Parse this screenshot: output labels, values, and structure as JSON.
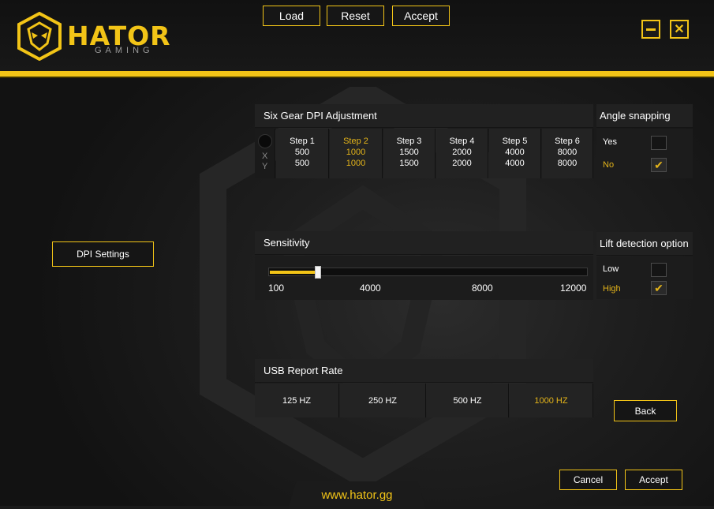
{
  "brand": {
    "name": "HATOR",
    "sub": "GAMING",
    "url": "www.hator.gg",
    "accent": "#f2c417"
  },
  "toolbar": {
    "load": "Load",
    "reset": "Reset",
    "accept": "Accept"
  },
  "window": {
    "minimize_icon": "minimize-icon",
    "close_icon": "close-icon"
  },
  "sidebar": {
    "dpi_settings": "DPI Settings"
  },
  "dpi": {
    "title": "Six Gear DPI Adjustment",
    "x_label": "X",
    "y_label": "Y",
    "steps": [
      {
        "label": "Step 1",
        "x": "500",
        "y": "500"
      },
      {
        "label": "Step 2",
        "x": "1000",
        "y": "1000"
      },
      {
        "label": "Step 3",
        "x": "1500",
        "y": "1500"
      },
      {
        "label": "Step 4",
        "x": "2000",
        "y": "2000"
      },
      {
        "label": "Step 5",
        "x": "4000",
        "y": "4000"
      },
      {
        "label": "Step 6",
        "x": "8000",
        "y": "8000"
      }
    ],
    "active_step": "Step 2"
  },
  "angle_snapping": {
    "title": "Angle snapping",
    "yes": "Yes",
    "no": "No",
    "selected": "No"
  },
  "sensitivity": {
    "title": "Sensitivity",
    "min": 100,
    "max": 12000,
    "value": 1000,
    "ticks": [
      "100",
      "4000",
      "8000",
      "12000"
    ]
  },
  "lift_detection": {
    "title": "Lift detection option",
    "low": "Low",
    "high": "High",
    "selected": "High"
  },
  "usb": {
    "title": "USB Report Rate",
    "options": [
      "125 HZ",
      "250 HZ",
      "500 HZ",
      "1000 HZ"
    ],
    "selected": "1000 HZ"
  },
  "actions": {
    "back": "Back",
    "cancel": "Cancel",
    "accept": "Accept"
  }
}
